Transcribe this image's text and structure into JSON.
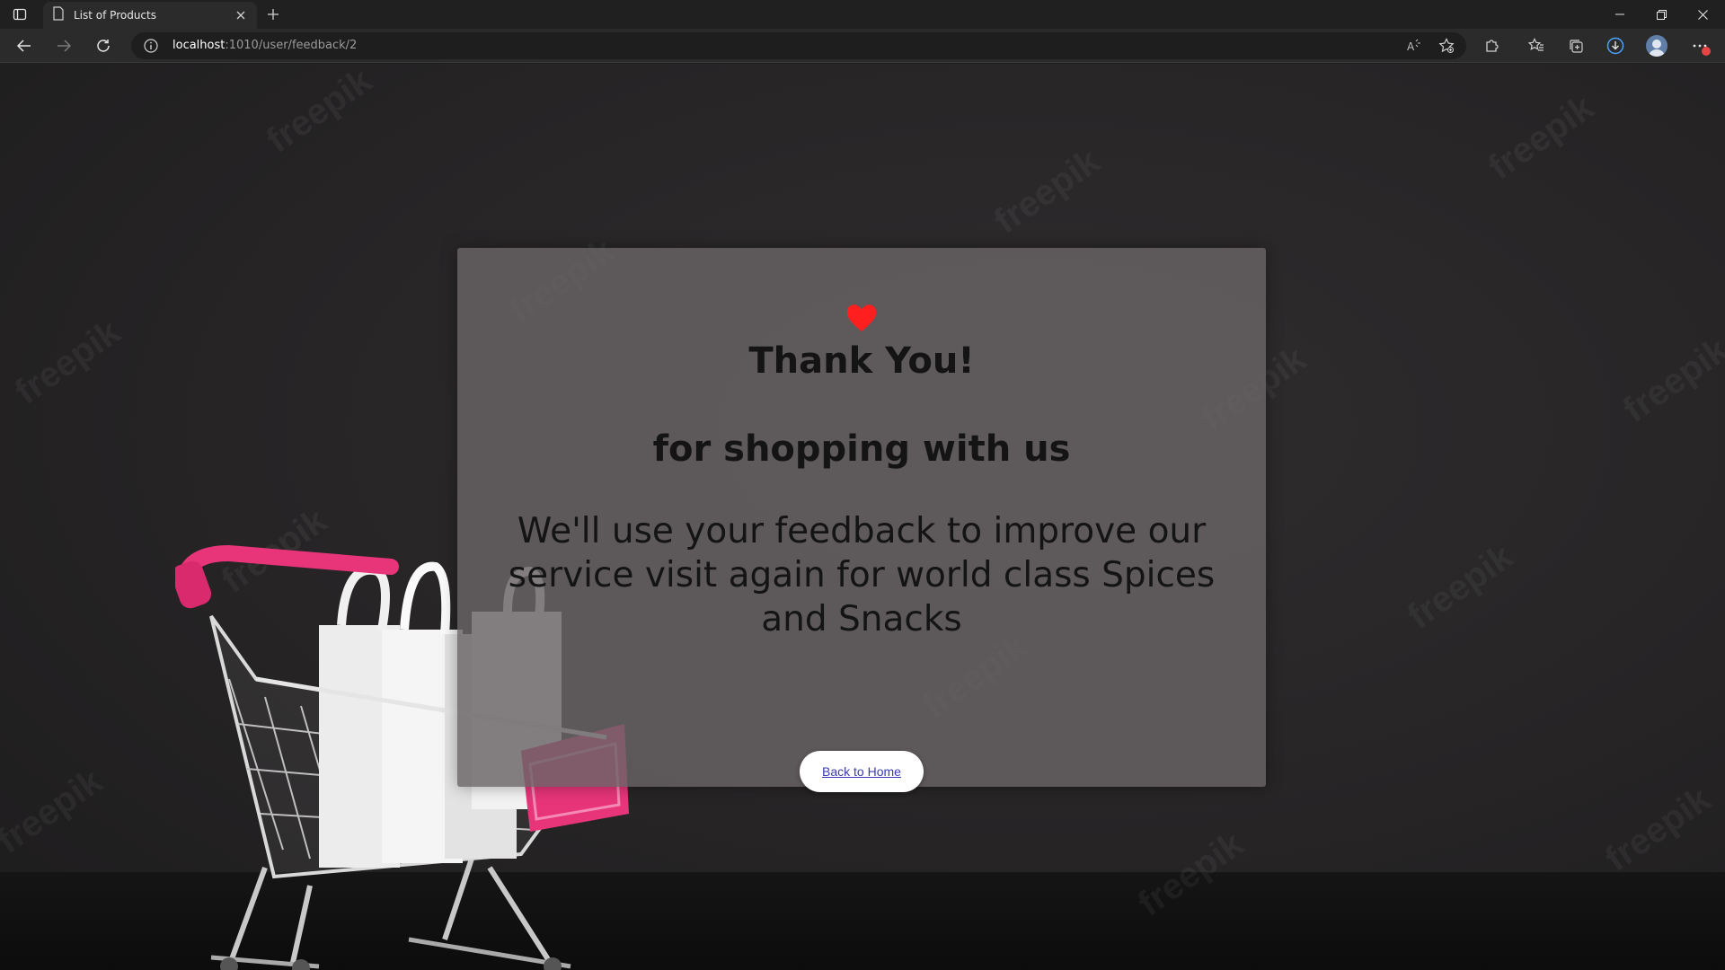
{
  "browser": {
    "tab_title": "List of Products",
    "url_host": "localhost",
    "url_path": ":1010/user/feedback/2",
    "icons": [
      "sidebar-toggle-icon",
      "page-icon",
      "close-icon",
      "plus-icon",
      "minimize-icon",
      "restore-icon",
      "close-window-icon",
      "back-icon",
      "forward-icon",
      "refresh-icon",
      "info-icon",
      "read-aloud-icon",
      "favorite-add-icon",
      "extensions-icon",
      "favorites-icon",
      "collections-icon",
      "downloads-icon",
      "avatar",
      "more-icon"
    ]
  },
  "page": {
    "heart": "♥",
    "heading": "Thank You!",
    "subheading": "for shopping with us",
    "message": "We'll use your feedback to improve our service visit again for world class Spices and Snacks",
    "button_label": "Back to Home",
    "watermark": "freepik",
    "colors": {
      "heart": "#ff1f1f",
      "card": "#69646580",
      "link": "#3b3bb0",
      "cart_pink": "#e8357a"
    }
  }
}
